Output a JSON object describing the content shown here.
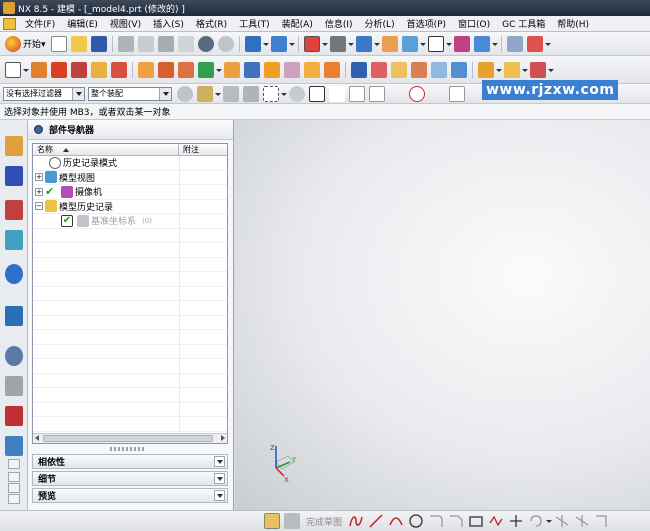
{
  "window": {
    "title": "NX 8.5 - 建模 - [_model4.prt (修改的) ]"
  },
  "menu": [
    "文件(F)",
    "编辑(E)",
    "视图(V)",
    "插入(S)",
    "格式(R)",
    "工具(T)",
    "装配(A)",
    "信息(I)",
    "分析(L)",
    "首选项(P)",
    "窗口(O)",
    "GC 工具箱",
    "帮助(H)"
  ],
  "toolbar": {
    "start_label": "开始▾"
  },
  "selection": {
    "filter": "没有选择过滤器",
    "scope": "整个装配"
  },
  "status": {
    "prompt": "选择对象并使用 MB3，或者双击某一对象"
  },
  "watermark": "www.rjzxw.com",
  "navigator": {
    "title": "部件导航器",
    "col_name": "名称",
    "col_note": "附注",
    "rows": [
      {
        "label": "历史记录模式",
        "indent": 0,
        "expander": ""
      },
      {
        "label": "模型视图",
        "indent": 0,
        "expander": "+"
      },
      {
        "label": "摄像机",
        "indent": 0,
        "expander": "+"
      },
      {
        "label": "模型历史记录",
        "indent": 0,
        "expander": "−"
      },
      {
        "label": "基准坐标系",
        "suffix": "(0)",
        "indent": 1,
        "expander": ""
      }
    ],
    "sections": [
      "相依性",
      "细节",
      "预览"
    ]
  },
  "sketch": {
    "finish_label": "完成草图"
  },
  "triad": {
    "z": "Z",
    "y": "Y",
    "x": "X"
  }
}
